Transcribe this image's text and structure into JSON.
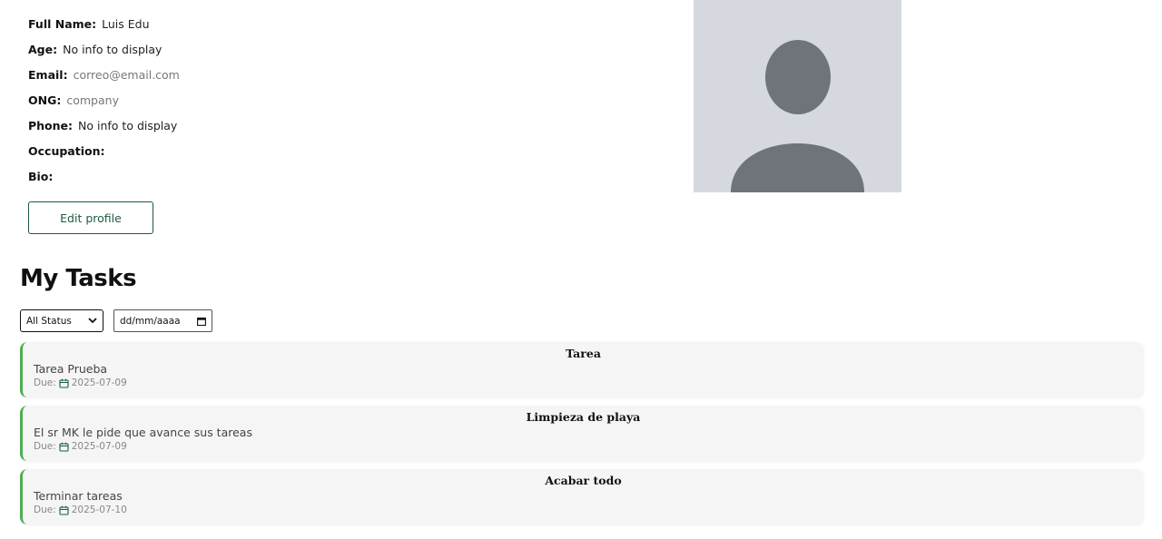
{
  "profile": {
    "fields": [
      {
        "label": "Full Name:",
        "value": "Luis Edu"
      },
      {
        "label": "Age:",
        "value": "No info to display"
      },
      {
        "label": "Email:",
        "value": "correo@email.com"
      },
      {
        "label": "ONG:",
        "value": "company"
      },
      {
        "label": "Phone:",
        "value": "No info to display"
      },
      {
        "label": "Occupation:",
        "value": ""
      },
      {
        "label": "Bio:",
        "value": ""
      }
    ],
    "edit_label": "Edit profile",
    "avatar_icon": "user-silhouette-icon"
  },
  "tasks": {
    "title": "My Tasks",
    "status_filter": {
      "selected": "All Status"
    },
    "date_filter": {
      "placeholder": "dd/mm/aaaa"
    },
    "due_label": "Due:",
    "items": [
      {
        "title": "Tarea",
        "description": "Tarea Prueba",
        "due": "2025-07-09"
      },
      {
        "title": "Limpieza de playa",
        "description": "El sr MK le pide que avance sus tareas",
        "due": "2025-07-09"
      },
      {
        "title": "Acabar todo",
        "description": "Terminar tareas",
        "due": "2025-07-10"
      }
    ]
  },
  "colors": {
    "accent": "#1d5b3c",
    "task_border": "#4caf50",
    "avatar_bg": "#d5d9df",
    "avatar_fg": "#6f747b"
  }
}
